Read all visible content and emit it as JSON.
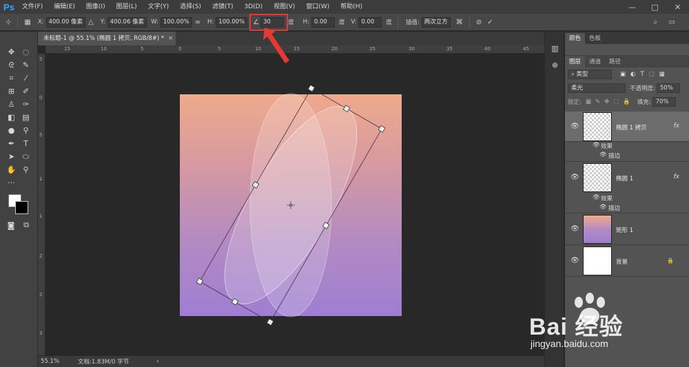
{
  "app": {
    "logo": "Ps",
    "menus": [
      "文件(F)",
      "编辑(E)",
      "图像(I)",
      "图层(L)",
      "文字(Y)",
      "选择(S)",
      "滤镜(T)",
      "3D(D)",
      "视图(V)",
      "窗口(W)",
      "帮助(H)"
    ],
    "window_controls": [
      "—",
      "□",
      "✕"
    ]
  },
  "options": {
    "x_label": "X:",
    "x_value": "400.00 像素",
    "y_label": "Y:",
    "y_value": "400.06 像素",
    "w_label": "W:",
    "w_value": "100.00%",
    "h_label": "H:",
    "h_value": "100.00%",
    "angle_value": "30",
    "angle_unit": "度",
    "hskew_label": "H:",
    "hskew_value": "0.00",
    "hskew_unit": "度",
    "vskew_label": "V:",
    "vskew_value": "0.00",
    "vskew_unit": "度",
    "interp_label": "插值:",
    "interp_value": "两次立方"
  },
  "document": {
    "tab_title": "未标题-1 @ 55.1% (椭圆 1 拷贝, RGB/8#) *",
    "close": "×"
  },
  "rulers": {
    "top": [
      "15",
      "10",
      "5",
      "0",
      "5",
      "10",
      "15",
      "20",
      "25",
      "30",
      "35",
      "40",
      "45"
    ],
    "left": [
      "5",
      "0",
      "5",
      "1",
      "1",
      "2",
      "2",
      "3"
    ]
  },
  "status": {
    "zoom": "55.1%",
    "doc_size": "文档:1.83M/0 字节"
  },
  "panel": {
    "top_tabs": [
      "颜色",
      "色板"
    ],
    "tabs": [
      "图层",
      "通道",
      "路径"
    ],
    "filter_placeholder": "类型",
    "blend_mode": "柔光",
    "opacity_label": "不透明度:",
    "opacity_value": "50%",
    "lock_label": "锁定:",
    "fill_label": "填充:",
    "fill_value": "70%",
    "layers": [
      {
        "name": "椭圆 1 拷贝",
        "fx": "fx",
        "effects_label": "效果",
        "stroke_label": "描边"
      },
      {
        "name": "椭圆 1",
        "fx": "fx",
        "effects_label": "效果",
        "stroke_label": "描边"
      },
      {
        "name": "矩形 1"
      },
      {
        "name": "背景"
      }
    ]
  },
  "watermark": {
    "brand": "Bai 经验",
    "url": "jingyan.baidu.com"
  },
  "colors": {
    "highlight": "#e53935",
    "accent": "#31a8ff"
  }
}
